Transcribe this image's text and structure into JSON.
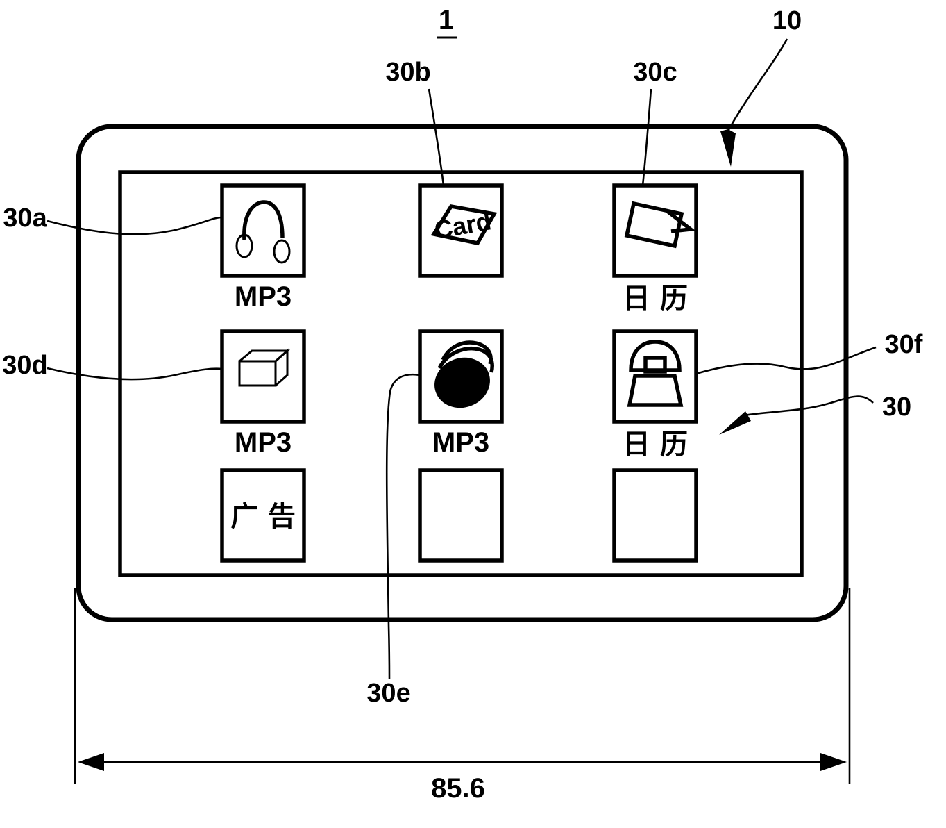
{
  "figure": {
    "title": "1",
    "dimension_label": "85.6"
  },
  "reference_labels": {
    "device": "10",
    "icon_group": "30",
    "icon_a": "30a",
    "icon_b": "30b",
    "icon_c": "30c",
    "icon_d": "30d",
    "icon_e": "30e",
    "icon_f": "30f"
  },
  "icons": [
    {
      "ref": "30a",
      "glyph": "headphones-icon",
      "caption": "MP3",
      "row": 1,
      "col": 1
    },
    {
      "ref": "30b",
      "glyph": "card-icon",
      "inner_text": "Card",
      "caption": "",
      "row": 1,
      "col": 2
    },
    {
      "ref": "30c",
      "glyph": "calendar-icon",
      "caption": "日 历",
      "row": 1,
      "col": 3
    },
    {
      "ref": "30d",
      "glyph": "cube-icon",
      "caption": "MP3",
      "row": 2,
      "col": 1
    },
    {
      "ref": "30e",
      "glyph": "camera-lens-icon",
      "caption": "MP3",
      "row": 2,
      "col": 2
    },
    {
      "ref": "30f",
      "glyph": "telephone-icon",
      "caption": "日 历",
      "row": 2,
      "col": 3
    },
    {
      "ref": "",
      "glyph": "text-icon",
      "inner_text": "广 告",
      "caption": "",
      "row": 3,
      "col": 1
    },
    {
      "ref": "",
      "glyph": "empty-icon",
      "caption": "",
      "row": 3,
      "col": 2
    },
    {
      "ref": "",
      "glyph": "empty-icon",
      "caption": "",
      "row": 3,
      "col": 3
    }
  ],
  "colors": {
    "line": "#000000",
    "background": "#ffffff"
  }
}
